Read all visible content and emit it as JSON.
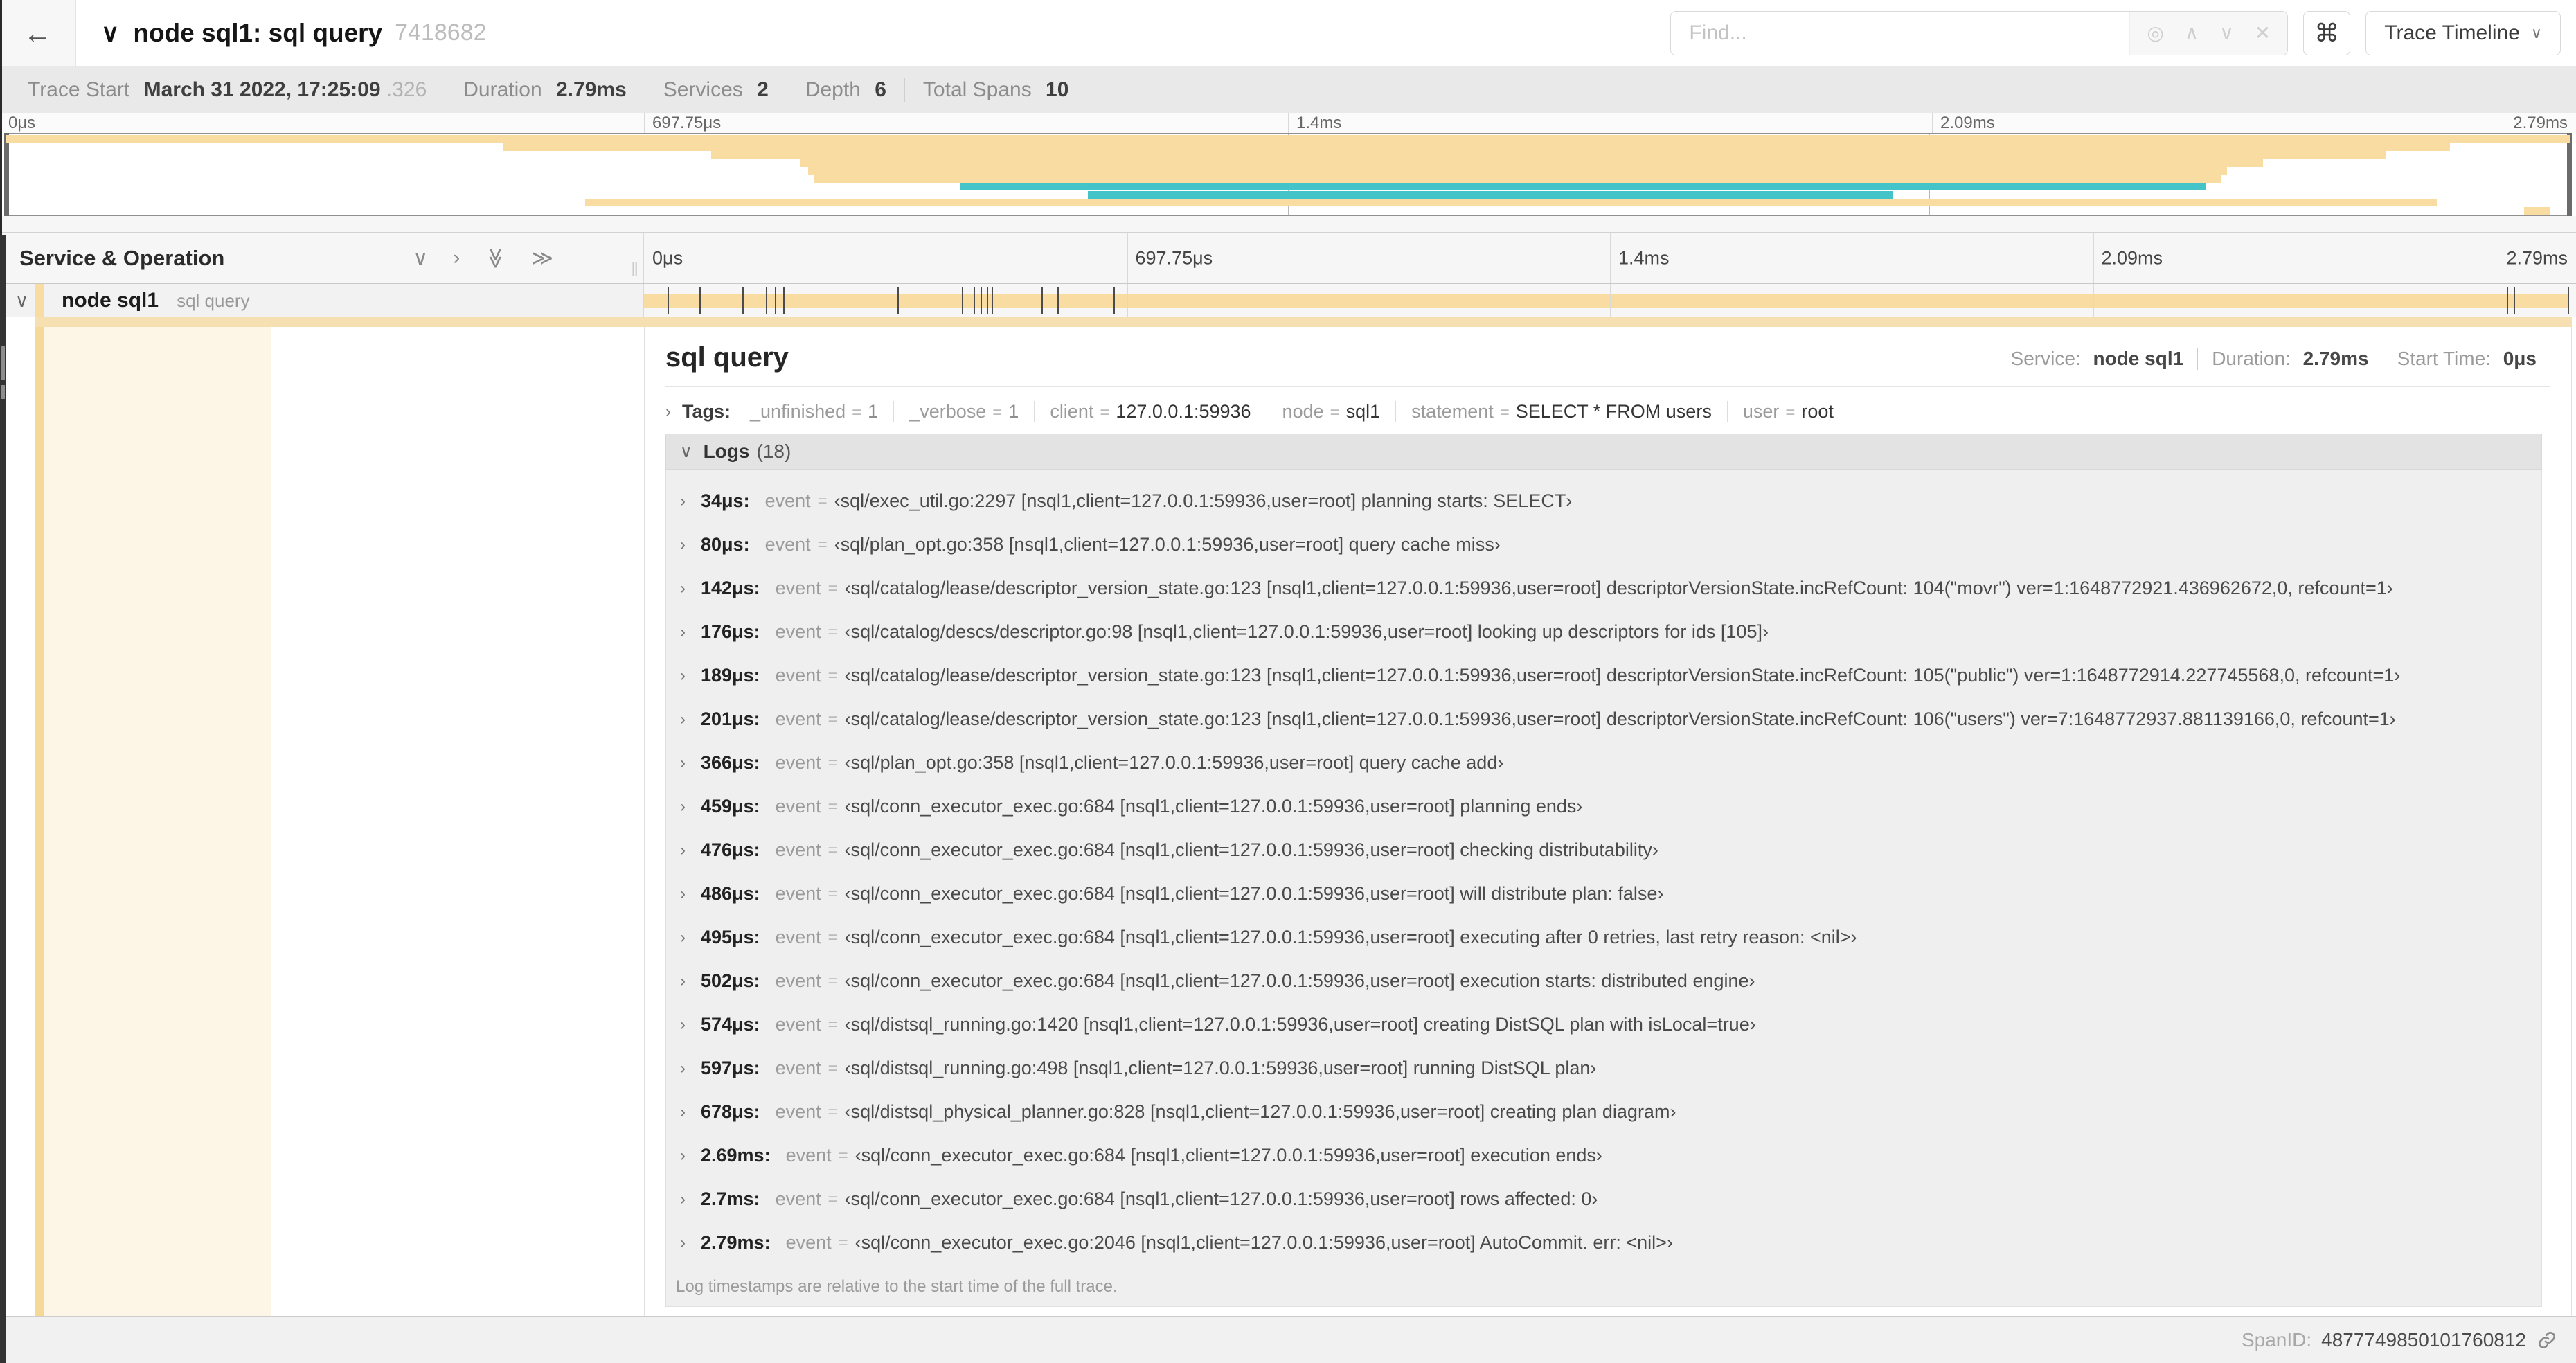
{
  "header": {
    "back_label": "←",
    "title": "node sql1: sql query",
    "trace_id": "7418682",
    "find_placeholder": "Find...",
    "shortcut_icon": "⌘",
    "view_selector_label": "Trace Timeline",
    "find_icons": [
      "◎",
      "∧",
      "∨",
      "✕"
    ]
  },
  "trace_meta": [
    {
      "label": "Trace Start",
      "value": "March 31 2022, 17:25:09",
      "suffix": ".326"
    },
    {
      "label": "Duration",
      "value": "2.79ms"
    },
    {
      "label": "Services",
      "value": "2"
    },
    {
      "label": "Depth",
      "value": "6"
    },
    {
      "label": "Total Spans",
      "value": "10"
    }
  ],
  "timeline_ticks": [
    {
      "label": "0μs",
      "pct": 0
    },
    {
      "label": "697.75μs",
      "pct": 25
    },
    {
      "label": "1.4ms",
      "pct": 50
    },
    {
      "label": "2.09ms",
      "pct": 75
    },
    {
      "label": "2.79ms",
      "pct": 100
    }
  ],
  "minimap_spans": [
    {
      "row": 0,
      "start_pct": 0,
      "end_pct": 100,
      "color": "tan"
    },
    {
      "row": 1,
      "start_pct": 19.4,
      "end_pct": 95.3,
      "color": "tan"
    },
    {
      "row": 2,
      "start_pct": 27.5,
      "end_pct": 92.8,
      "color": "tan"
    },
    {
      "row": 3,
      "start_pct": 31.0,
      "end_pct": 88.0,
      "color": "tan"
    },
    {
      "row": 4,
      "start_pct": 31.3,
      "end_pct": 86.6,
      "color": "tan"
    },
    {
      "row": 5,
      "start_pct": 31.5,
      "end_pct": 86.4,
      "color": "tan"
    },
    {
      "row": 6,
      "start_pct": 37.2,
      "end_pct": 85.8,
      "color": "teal"
    },
    {
      "row": 7,
      "start_pct": 42.2,
      "end_pct": 73.6,
      "color": "teal"
    },
    {
      "row": 8,
      "start_pct": 22.6,
      "end_pct": 94.8,
      "color": "tan"
    },
    {
      "row": 9,
      "start_pct": 98.2,
      "end_pct": 99.2,
      "color": "tan"
    }
  ],
  "service_column": {
    "title": "Service & Operation"
  },
  "span_row": {
    "service": "node sql1",
    "operation": "sql query",
    "duration_us": 2790,
    "marker_offsets_us": [
      34,
      80,
      142,
      176,
      189,
      201,
      366,
      459,
      476,
      486,
      495,
      502,
      574,
      597,
      678,
      2690,
      2700,
      2778
    ]
  },
  "span_detail": {
    "title": "sql query",
    "meta": [
      {
        "label": "Service:",
        "value": "node sql1"
      },
      {
        "label": "Duration:",
        "value": "2.79ms"
      },
      {
        "label": "Start Time:",
        "value": "0μs"
      }
    ],
    "tags_label": "Tags:",
    "tags": [
      {
        "key": "_unfinished",
        "value": "1",
        "muted": true
      },
      {
        "key": "_verbose",
        "value": "1",
        "muted": true
      },
      {
        "key": "client",
        "value": "127.0.0.1:59936"
      },
      {
        "key": "node",
        "value": "sql1"
      },
      {
        "key": "statement",
        "value": "SELECT * FROM users"
      },
      {
        "key": "user",
        "value": "root"
      }
    ],
    "logs": {
      "title": "Logs",
      "count": "(18)",
      "event_key": "event",
      "entries": [
        {
          "ts": "34μs:",
          "value": "‹sql/exec_util.go:2297 [nsql1,client=127.0.0.1:59936,user=root] planning starts: SELECT›"
        },
        {
          "ts": "80μs:",
          "value": "‹sql/plan_opt.go:358 [nsql1,client=127.0.0.1:59936,user=root] query cache miss›"
        },
        {
          "ts": "142μs:",
          "value": "‹sql/catalog/lease/descriptor_version_state.go:123 [nsql1,client=127.0.0.1:59936,user=root] descriptorVersionState.incRefCount: 104(\"movr\") ver=1:1648772921.436962672,0, refcount=1›"
        },
        {
          "ts": "176μs:",
          "value": "‹sql/catalog/descs/descriptor.go:98 [nsql1,client=127.0.0.1:59936,user=root] looking up descriptors for ids [105]›"
        },
        {
          "ts": "189μs:",
          "value": "‹sql/catalog/lease/descriptor_version_state.go:123 [nsql1,client=127.0.0.1:59936,user=root] descriptorVersionState.incRefCount: 105(\"public\") ver=1:1648772914.227745568,0, refcount=1›"
        },
        {
          "ts": "201μs:",
          "value": "‹sql/catalog/lease/descriptor_version_state.go:123 [nsql1,client=127.0.0.1:59936,user=root] descriptorVersionState.incRefCount: 106(\"users\") ver=7:1648772937.881139166,0, refcount=1›"
        },
        {
          "ts": "366μs:",
          "value": "‹sql/plan_opt.go:358 [nsql1,client=127.0.0.1:59936,user=root] query cache add›"
        },
        {
          "ts": "459μs:",
          "value": "‹sql/conn_executor_exec.go:684 [nsql1,client=127.0.0.1:59936,user=root] planning ends›"
        },
        {
          "ts": "476μs:",
          "value": "‹sql/conn_executor_exec.go:684 [nsql1,client=127.0.0.1:59936,user=root] checking distributability›"
        },
        {
          "ts": "486μs:",
          "value": "‹sql/conn_executor_exec.go:684 [nsql1,client=127.0.0.1:59936,user=root] will distribute plan: false›"
        },
        {
          "ts": "495μs:",
          "value": "‹sql/conn_executor_exec.go:684 [nsql1,client=127.0.0.1:59936,user=root] executing after 0 retries, last retry reason: <nil>›"
        },
        {
          "ts": "502μs:",
          "value": "‹sql/conn_executor_exec.go:684 [nsql1,client=127.0.0.1:59936,user=root] execution starts: distributed engine›"
        },
        {
          "ts": "574μs:",
          "value": "‹sql/distsql_running.go:1420 [nsql1,client=127.0.0.1:59936,user=root] creating DistSQL plan with isLocal=true›"
        },
        {
          "ts": "597μs:",
          "value": "‹sql/distsql_running.go:498 [nsql1,client=127.0.0.1:59936,user=root] running DistSQL plan›"
        },
        {
          "ts": "678μs:",
          "value": "‹sql/distsql_physical_planner.go:828 [nsql1,client=127.0.0.1:59936,user=root] creating plan diagram›"
        },
        {
          "ts": "2.69ms:",
          "value": "‹sql/conn_executor_exec.go:684 [nsql1,client=127.0.0.1:59936,user=root] execution ends›"
        },
        {
          "ts": "2.7ms:",
          "value": "‹sql/conn_executor_exec.go:684 [nsql1,client=127.0.0.1:59936,user=root] rows affected: 0›"
        },
        {
          "ts": "2.79ms:",
          "value": "‹sql/conn_executor_exec.go:2046 [nsql1,client=127.0.0.1:59936,user=root] AutoCommit. err: <nil>›"
        }
      ],
      "note": "Log timestamps are relative to the start time of the full trace."
    },
    "footer": {
      "label": "SpanID:",
      "value": "4877749850101760812"
    }
  },
  "colors": {
    "tan": "#f8dca1",
    "teal": "#44c4c8",
    "tan_light": "#f6dfb0",
    "indent_tan": "#f4d999",
    "cream": "#fdf6e7"
  }
}
